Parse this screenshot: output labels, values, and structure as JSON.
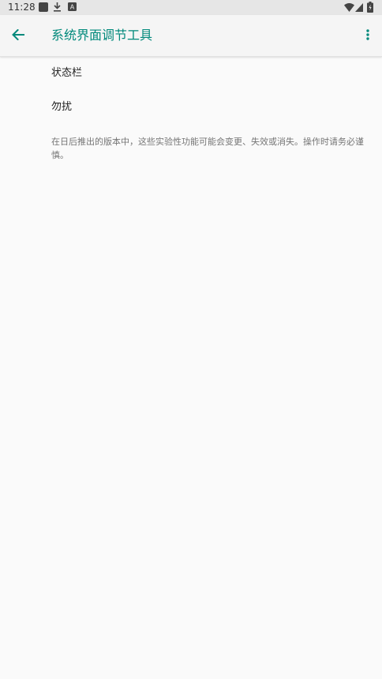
{
  "status_bar": {
    "time": "11:28",
    "icons_left": [
      "app-notification-icon",
      "download-icon",
      "a-badge-icon"
    ],
    "icons_right": [
      "wifi-icon",
      "signal-icon",
      "battery-icon"
    ]
  },
  "app_bar": {
    "title": "系统界面调节工具",
    "accent_color": "#00897b"
  },
  "preferences": [
    {
      "label": "状态栏"
    },
    {
      "label": "勿扰"
    }
  ],
  "footer": {
    "note": "在日后推出的版本中，这些实验性功能可能会变更、失效或消失。操作时请务必谨慎。"
  }
}
